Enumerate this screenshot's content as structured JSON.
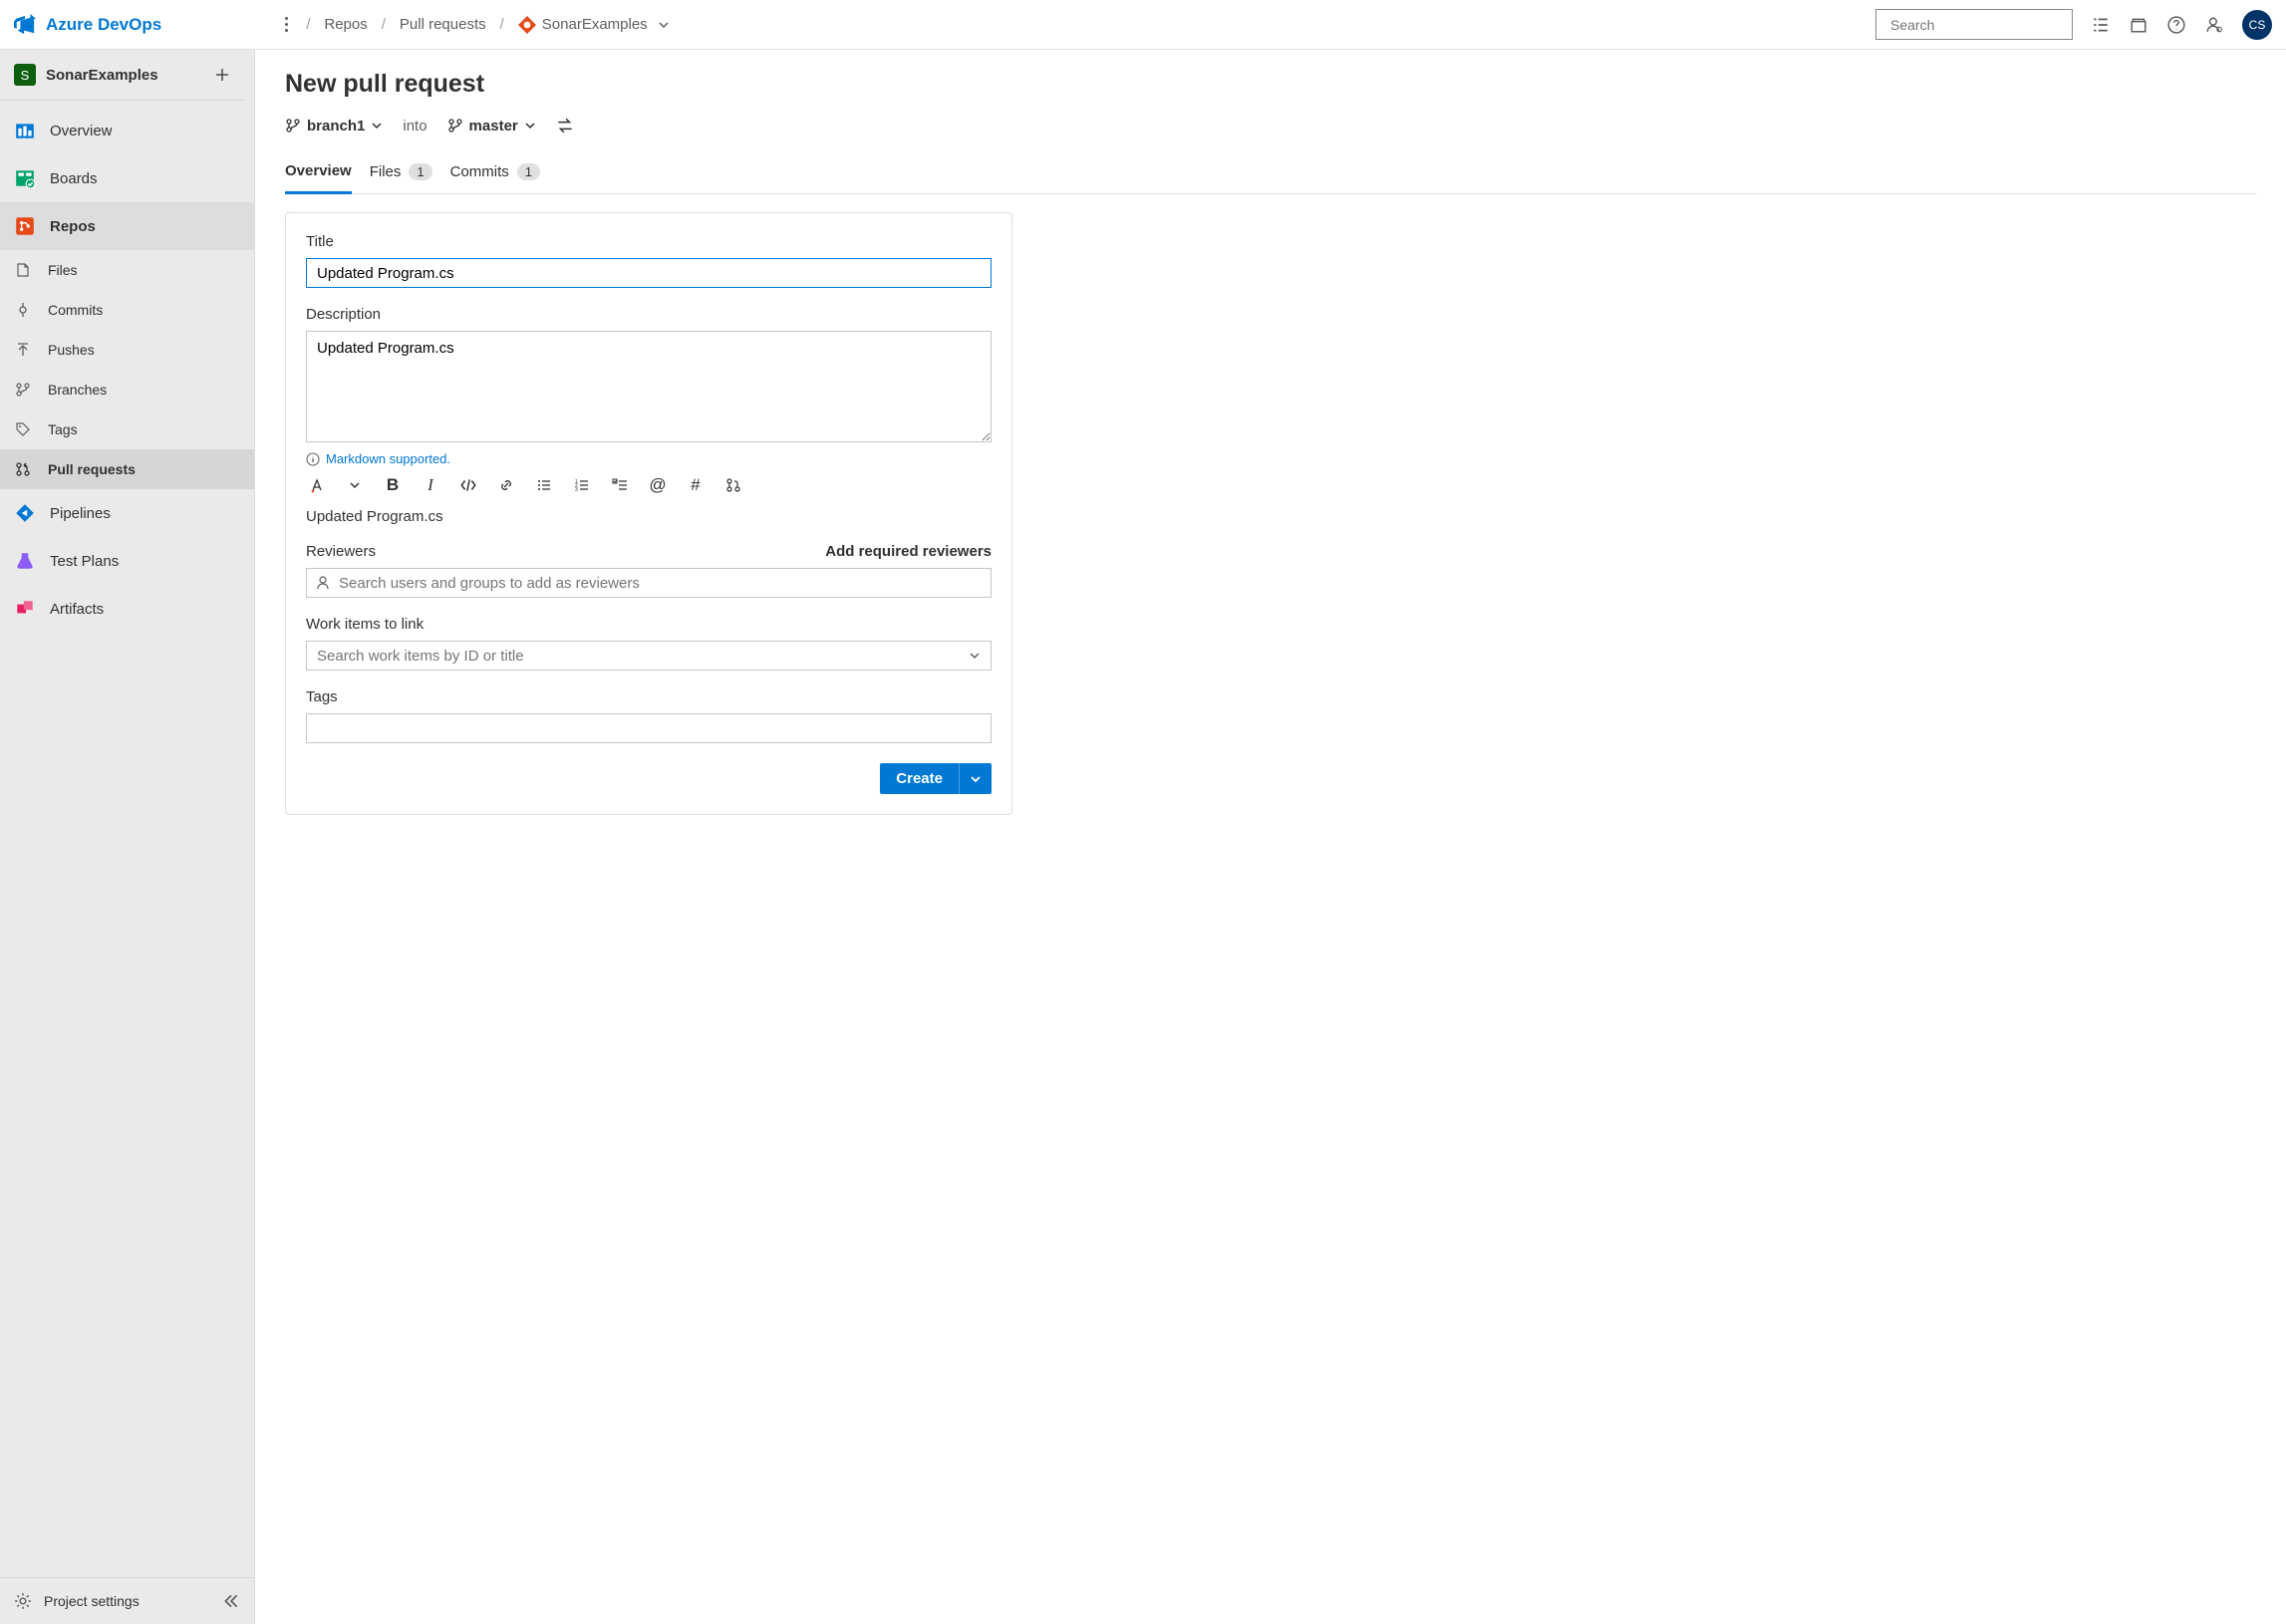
{
  "brand": "Azure DevOps",
  "breadcrumb": {
    "repos": "Repos",
    "pullRequests": "Pull requests",
    "repo": "SonarExamples"
  },
  "search": {
    "placeholder": "Search"
  },
  "avatar": "CS",
  "project": {
    "badge": "S",
    "name": "SonarExamples"
  },
  "nav": {
    "overview": "Overview",
    "boards": "Boards",
    "repos": "Repos",
    "files": "Files",
    "commits": "Commits",
    "pushes": "Pushes",
    "branches": "Branches",
    "tags": "Tags",
    "pullRequests": "Pull requests",
    "pipelines": "Pipelines",
    "testPlans": "Test Plans",
    "artifacts": "Artifacts",
    "projectSettings": "Project settings"
  },
  "page": {
    "title": "New pull request",
    "sourceBranch": "branch1",
    "into": "into",
    "targetBranch": "master"
  },
  "tabs": {
    "overview": "Overview",
    "files": "Files",
    "filesCount": "1",
    "commits": "Commits",
    "commitsCount": "1"
  },
  "form": {
    "titleLabel": "Title",
    "titleValue": "Updated Program.cs",
    "descLabel": "Description",
    "descValue": "Updated Program.cs",
    "markdownHint": "Markdown supported.",
    "previewText": "Updated Program.cs",
    "reviewersLabel": "Reviewers",
    "addRequired": "Add required reviewers",
    "reviewersPlaceholder": "Search users and groups to add as reviewers",
    "workItemsLabel": "Work items to link",
    "workItemsPlaceholder": "Search work items by ID or title",
    "tagsLabel": "Tags",
    "createLabel": "Create"
  }
}
